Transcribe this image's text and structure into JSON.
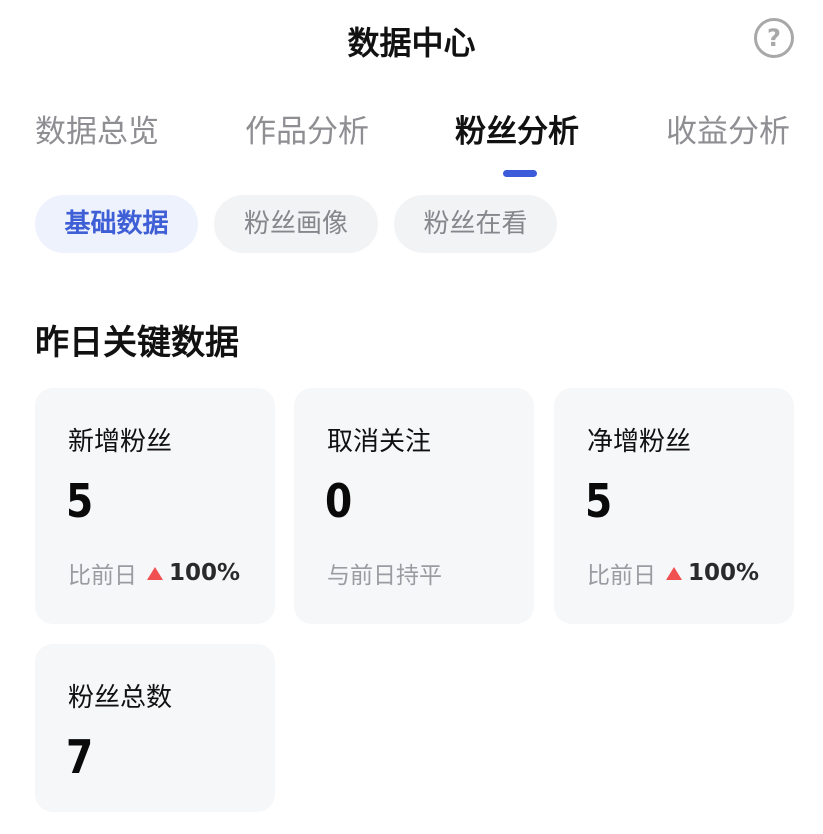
{
  "header": {
    "title": "数据中心",
    "help_glyph": "?"
  },
  "tabs": [
    {
      "label": "数据总览"
    },
    {
      "label": "作品分析"
    },
    {
      "label": "粉丝分析"
    },
    {
      "label": "收益分析"
    }
  ],
  "chips": [
    {
      "label": "基础数据"
    },
    {
      "label": "粉丝画像"
    },
    {
      "label": "粉丝在看"
    }
  ],
  "section": {
    "title": "昨日关键数据"
  },
  "cards": [
    {
      "label": "新增粉丝",
      "value": "5",
      "compare_label": "比前日",
      "change": "100%",
      "trend": "up"
    },
    {
      "label": "取消关注",
      "value": "0",
      "compare_label": "与前日持平"
    },
    {
      "label": "净增粉丝",
      "value": "5",
      "compare_label": "比前日",
      "change": "100%",
      "trend": "up"
    },
    {
      "label": "粉丝总数",
      "value": "7"
    }
  ],
  "colors": {
    "accent": "#3b5bdb",
    "up": "#f05050",
    "card_bg": "#f6f7f9",
    "chip_bg": "#f2f3f5",
    "chip_active_bg": "#eef2fd"
  }
}
